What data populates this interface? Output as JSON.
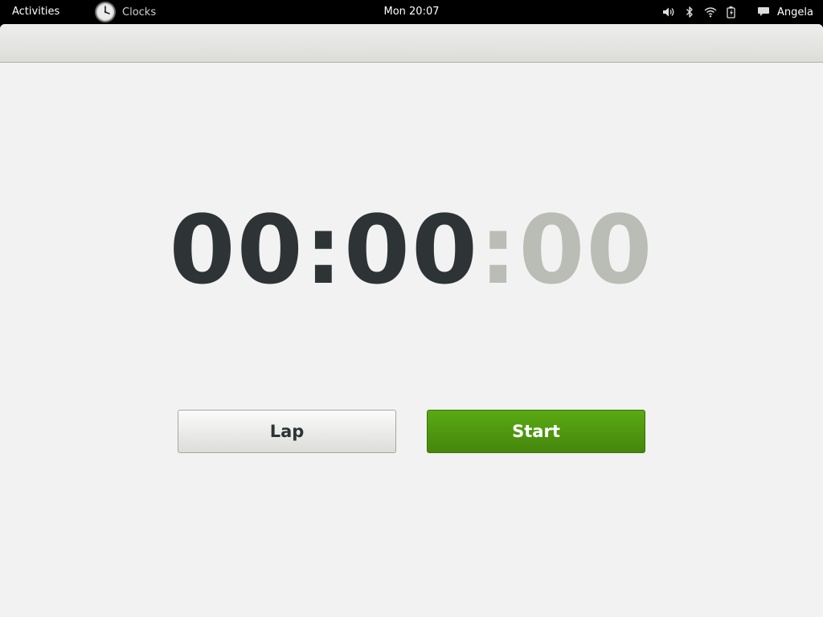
{
  "topbar": {
    "activities_label": "Activities",
    "app_name": "Clocks",
    "app_icon": "clock-icon",
    "clock": "Mon 20:07",
    "status_icons": [
      "volume-icon",
      "bluetooth-icon",
      "wifi-icon",
      "battery-icon",
      "chat-icon"
    ],
    "user_name": "Angela"
  },
  "stopwatch": {
    "hours": "00",
    "separator1": ":",
    "minutes": "00",
    "separator2": ":",
    "seconds": "00"
  },
  "buttons": {
    "lap_label": "Lap",
    "start_label": "Start"
  },
  "colors": {
    "accent_green": "#4e9a06",
    "text_dark": "#2e3436",
    "text_dim": "#babdb6",
    "window_bg": "#f2f2f2"
  }
}
